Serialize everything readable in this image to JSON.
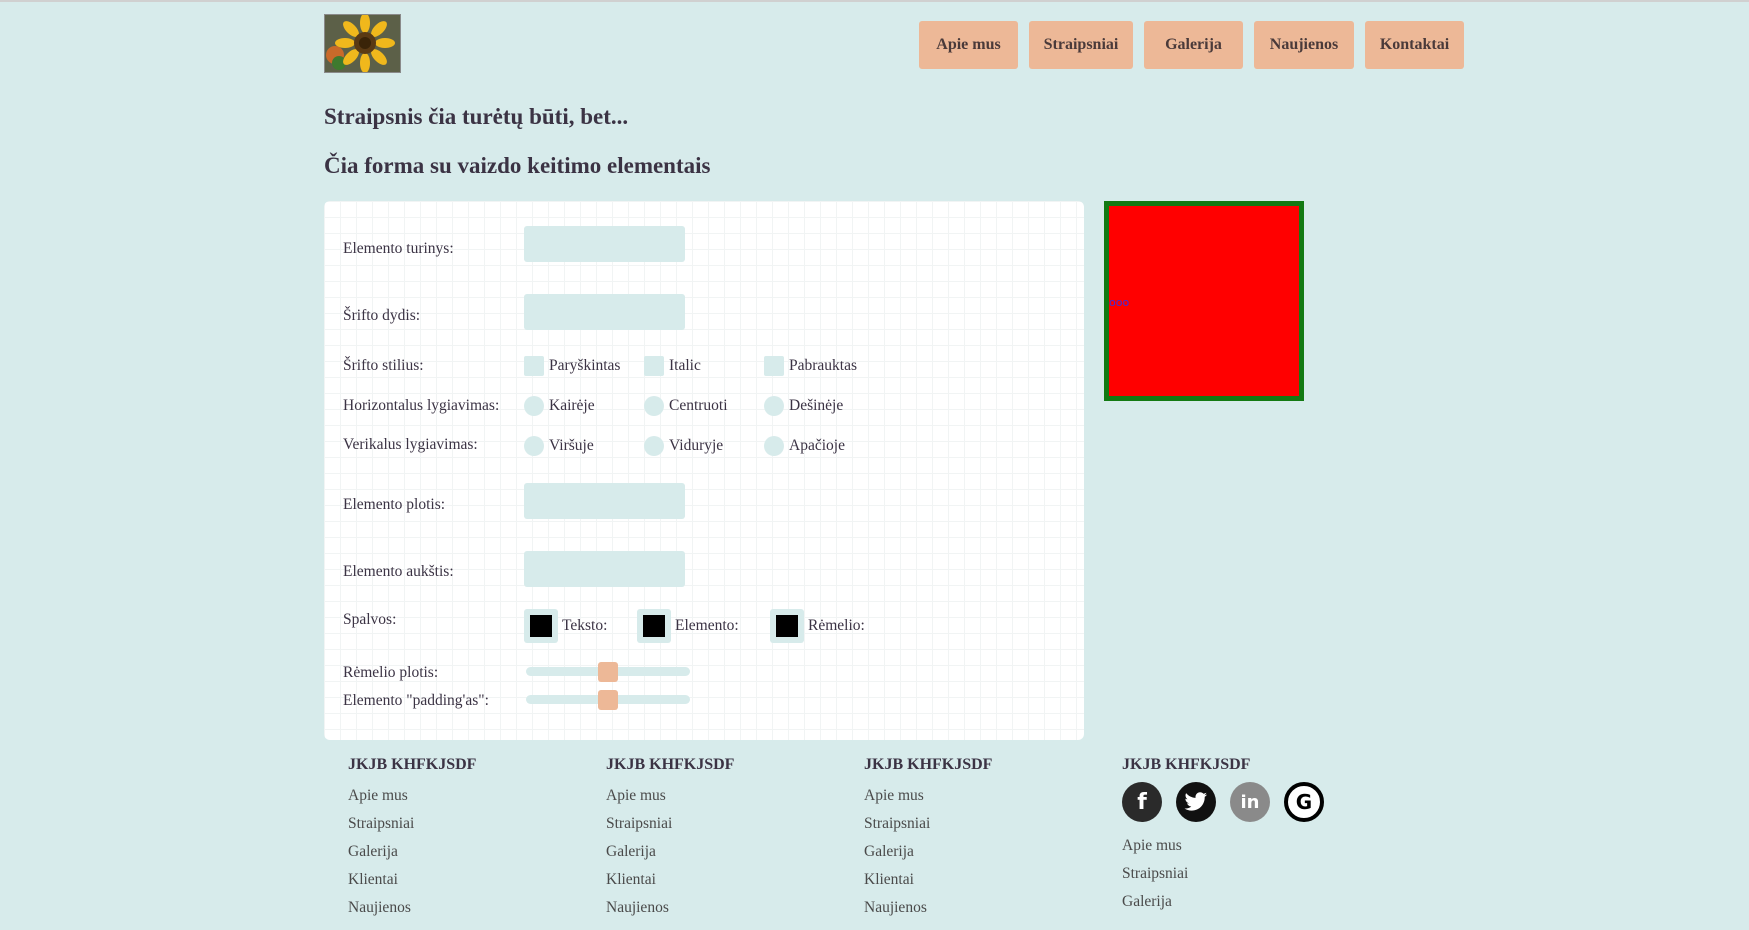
{
  "header": {
    "logo": "sunflower-logo",
    "nav": [
      "Apie mus",
      "Straipsniai",
      "Galerija",
      "Naujienos",
      "Kontaktai"
    ]
  },
  "main": {
    "title": "Straipsnis čia turėtų būti, bet...",
    "subtitle": "Čia forma su vaizdo keitimo elementais"
  },
  "form": {
    "content_label": "Elemento turinys:",
    "font_size_label": "Šrifto dydis:",
    "font_style_label": "Šrifto stilius:",
    "font_styles": [
      "Paryškintas",
      "Italic",
      "Pabrauktas"
    ],
    "halign_label": "Horizontalus lygiavimas:",
    "halign_options": [
      "Kairėje",
      "Centruoti",
      "Dešinėje"
    ],
    "valign_label": "Verikalus lygiavimas:",
    "valign_options": [
      "Viršuje",
      "Viduryje",
      "Apačioje"
    ],
    "width_label": "Elemento plotis:",
    "height_label": "Elemento aukštis:",
    "colors_label": "Spalvos:",
    "color_options": [
      "Teksto:",
      "Elemento:",
      "Rėmelio:"
    ],
    "border_width_label": "Rėmelio plotis:",
    "padding_label": "Elemento \"padding'as\":",
    "border_width_value": 0.5,
    "padding_value": 0.5
  },
  "preview": {
    "text": "ooo",
    "background": "#ff0000",
    "border_color": "#137a13"
  },
  "footer": {
    "columns": [
      {
        "title": "JKJB KHFKJSDF",
        "links": [
          "Apie mus",
          "Straipsniai",
          "Galerija",
          "Klientai",
          "Naujienos"
        ]
      },
      {
        "title": "JKJB KHFKJSDF",
        "links": [
          "Apie mus",
          "Straipsniai",
          "Galerija",
          "Klientai",
          "Naujienos"
        ]
      },
      {
        "title": "JKJB KHFKJSDF",
        "links": [
          "Apie mus",
          "Straipsniai",
          "Galerija",
          "Klientai",
          "Naujienos"
        ]
      }
    ],
    "social_col": {
      "title": "JKJB KHFKJSDF",
      "icons": [
        "facebook-icon",
        "twitter-icon",
        "linkedin-icon",
        "google-icon"
      ],
      "links": [
        "Apie mus",
        "Straipsniai",
        "Galerija"
      ]
    }
  },
  "colors": {
    "background": "#d7ebeb",
    "accent": "#edb897"
  }
}
